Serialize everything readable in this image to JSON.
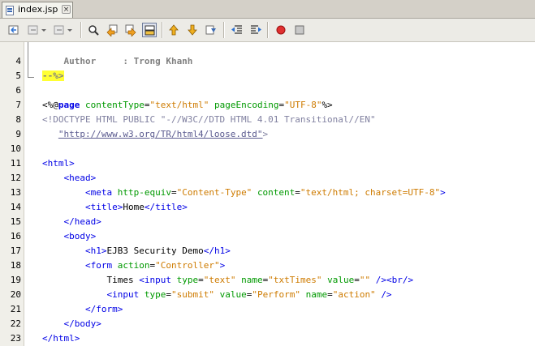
{
  "tab": {
    "title": "index.jsp",
    "close": "×"
  },
  "toolbar": {
    "buttons": [
      "back-icon",
      "forward-dropdown-icon",
      "previous-edit-icon",
      "find-icon",
      "find-previous-icon",
      "find-next-icon",
      "toggle-highlight-icon",
      "previous-bookmark-icon",
      "next-bookmark-icon",
      "toggle-bookmark-icon",
      "shift-left-icon",
      "shift-right-icon",
      "record-macro-icon",
      "stop-macro-icon"
    ]
  },
  "editor": {
    "line_numbers": [
      "4",
      "5",
      "6",
      "7",
      "8",
      "9",
      "10",
      "11",
      "12",
      "13",
      "14",
      "15",
      "16",
      "17",
      "18",
      "19",
      "20",
      "21",
      "22",
      "23"
    ],
    "lines": [
      [
        {
          "t": "    Author     : Trong Khanh",
          "c": "k-cmt"
        }
      ],
      [
        {
          "t": "--%>",
          "c": "k-hl"
        }
      ],
      [],
      [
        {
          "t": "<%@",
          "c": "k-dir"
        },
        {
          "t": "page",
          "c": "k-dkw"
        },
        {
          "t": " ",
          "c": ""
        },
        {
          "t": "contentType",
          "c": "k-attr"
        },
        {
          "t": "=",
          "c": ""
        },
        {
          "t": "\"text/html\"",
          "c": "k-val"
        },
        {
          "t": " ",
          "c": ""
        },
        {
          "t": "pageEncoding",
          "c": "k-attr"
        },
        {
          "t": "=",
          "c": ""
        },
        {
          "t": "\"UTF-8\"",
          "c": "k-val"
        },
        {
          "t": "%>",
          "c": "k-dir"
        }
      ],
      [
        {
          "t": "<!DOCTYPE HTML PUBLIC \"-//W3C//DTD HTML 4.01 Transitional//EN\"",
          "c": "k-doctype"
        }
      ],
      [
        {
          "t": "   ",
          "c": ""
        },
        {
          "t": "\"http://www.w3.org/TR/html4/loose.dtd\"",
          "c": "k-url"
        },
        {
          "t": ">",
          "c": "k-doctype"
        }
      ],
      [],
      [
        {
          "t": "<html>",
          "c": "k-tag"
        }
      ],
      [
        {
          "t": "    ",
          "c": ""
        },
        {
          "t": "<head>",
          "c": "k-tag"
        }
      ],
      [
        {
          "t": "        ",
          "c": ""
        },
        {
          "t": "<meta",
          "c": "k-tag"
        },
        {
          "t": " ",
          "c": ""
        },
        {
          "t": "http-equiv",
          "c": "k-attr"
        },
        {
          "t": "=",
          "c": ""
        },
        {
          "t": "\"Content-Type\"",
          "c": "k-val"
        },
        {
          "t": " ",
          "c": ""
        },
        {
          "t": "content",
          "c": "k-attr"
        },
        {
          "t": "=",
          "c": ""
        },
        {
          "t": "\"text/html; charset=UTF-8\"",
          "c": "k-val"
        },
        {
          "t": ">",
          "c": "k-tag"
        }
      ],
      [
        {
          "t": "        ",
          "c": ""
        },
        {
          "t": "<title>",
          "c": "k-tag"
        },
        {
          "t": "Home",
          "c": ""
        },
        {
          "t": "</title>",
          "c": "k-tag"
        }
      ],
      [
        {
          "t": "    ",
          "c": ""
        },
        {
          "t": "</head>",
          "c": "k-tag"
        }
      ],
      [
        {
          "t": "    ",
          "c": ""
        },
        {
          "t": "<body>",
          "c": "k-tag"
        }
      ],
      [
        {
          "t": "        ",
          "c": ""
        },
        {
          "t": "<h1>",
          "c": "k-tag"
        },
        {
          "t": "EJB3 Security Demo",
          "c": ""
        },
        {
          "t": "</h1>",
          "c": "k-tag"
        }
      ],
      [
        {
          "t": "        ",
          "c": ""
        },
        {
          "t": "<form",
          "c": "k-tag"
        },
        {
          "t": " ",
          "c": ""
        },
        {
          "t": "action",
          "c": "k-attr"
        },
        {
          "t": "=",
          "c": ""
        },
        {
          "t": "\"Controller\"",
          "c": "k-val"
        },
        {
          "t": ">",
          "c": "k-tag"
        }
      ],
      [
        {
          "t": "            Times ",
          "c": ""
        },
        {
          "t": "<input",
          "c": "k-tag"
        },
        {
          "t": " ",
          "c": ""
        },
        {
          "t": "type",
          "c": "k-attr"
        },
        {
          "t": "=",
          "c": ""
        },
        {
          "t": "\"text\"",
          "c": "k-val"
        },
        {
          "t": " ",
          "c": ""
        },
        {
          "t": "name",
          "c": "k-attr"
        },
        {
          "t": "=",
          "c": ""
        },
        {
          "t": "\"txtTimes\"",
          "c": "k-val"
        },
        {
          "t": " ",
          "c": ""
        },
        {
          "t": "value",
          "c": "k-attr"
        },
        {
          "t": "=",
          "c": ""
        },
        {
          "t": "\"\"",
          "c": "k-val"
        },
        {
          "t": " ",
          "c": ""
        },
        {
          "t": "/>",
          "c": "k-tag"
        },
        {
          "t": "<br/>",
          "c": "k-tag"
        }
      ],
      [
        {
          "t": "            ",
          "c": ""
        },
        {
          "t": "<input",
          "c": "k-tag"
        },
        {
          "t": " ",
          "c": ""
        },
        {
          "t": "type",
          "c": "k-attr"
        },
        {
          "t": "=",
          "c": ""
        },
        {
          "t": "\"submit\"",
          "c": "k-val"
        },
        {
          "t": " ",
          "c": ""
        },
        {
          "t": "value",
          "c": "k-attr"
        },
        {
          "t": "=",
          "c": ""
        },
        {
          "t": "\"Perform\"",
          "c": "k-val"
        },
        {
          "t": " ",
          "c": ""
        },
        {
          "t": "name",
          "c": "k-attr"
        },
        {
          "t": "=",
          "c": ""
        },
        {
          "t": "\"action\"",
          "c": "k-val"
        },
        {
          "t": " ",
          "c": ""
        },
        {
          "t": "/>",
          "c": "k-tag"
        }
      ],
      [
        {
          "t": "        ",
          "c": ""
        },
        {
          "t": "</form>",
          "c": "k-tag"
        }
      ],
      [
        {
          "t": "    ",
          "c": ""
        },
        {
          "t": "</body>",
          "c": "k-tag"
        }
      ],
      [
        {
          "t": "</html>",
          "c": "k-tag"
        }
      ]
    ]
  }
}
